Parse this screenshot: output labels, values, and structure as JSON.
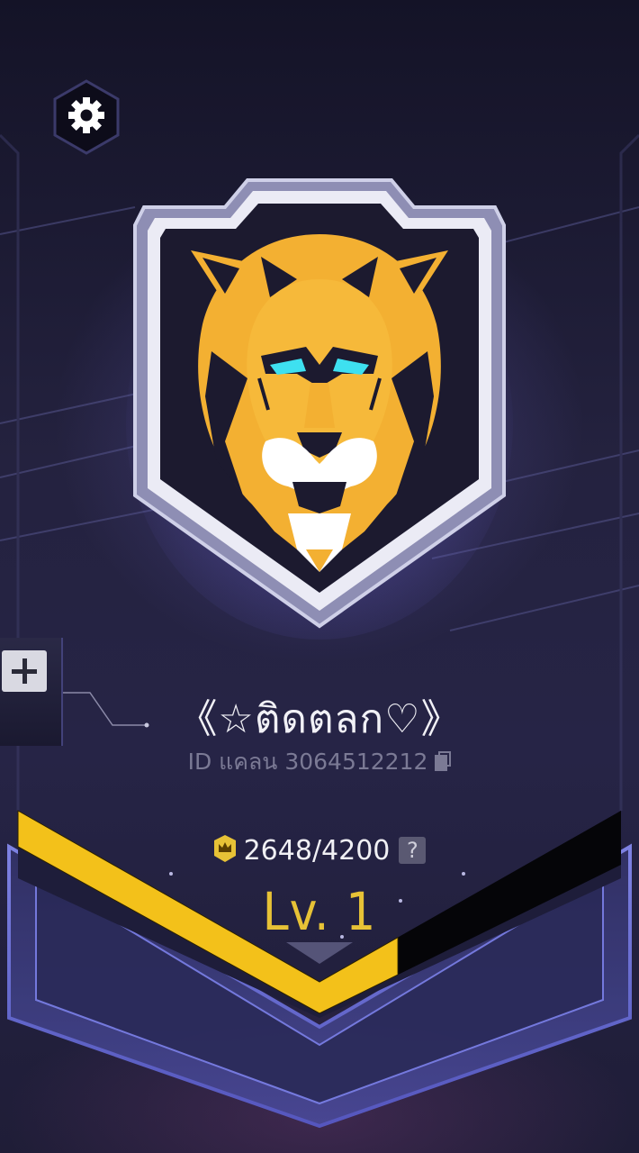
{
  "settings": {
    "icon": "gear-icon"
  },
  "clan": {
    "name": "《☆ติดตลก♡》",
    "id_text": "ID แคลน 3064512212"
  },
  "emblem": {
    "icon": "lion-shield-emblem",
    "accent": "#f3b032",
    "eye_color": "#3ee0f0"
  },
  "side_panel": {
    "icon": "plus-icon"
  },
  "xp": {
    "current": 2648,
    "max": 4200,
    "text": "2648/4200",
    "help_label": "?"
  },
  "level": {
    "label": "Lv. 1",
    "progress": 0.63
  },
  "colors": {
    "accent_gold": "#e7c236",
    "bar_yellow": "#f3c11a",
    "frame_blue": "#5f61c8",
    "background": "#1c1b34"
  }
}
